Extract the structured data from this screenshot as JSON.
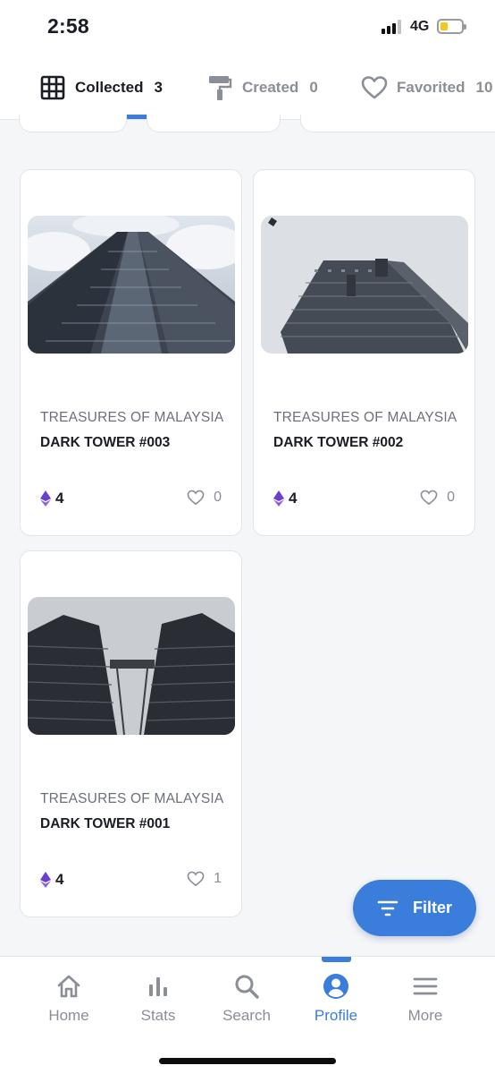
{
  "status_bar": {
    "time": "2:58",
    "network": "4G",
    "battery_level": 0.3
  },
  "tabs": [
    {
      "label": "Collected",
      "count": "3",
      "icon": "grid-icon",
      "active": true
    },
    {
      "label": "Created",
      "count": "0",
      "icon": "paint-roller-icon",
      "active": false
    },
    {
      "label": "Favorited",
      "count": "10",
      "icon": "heart-icon",
      "active": false
    }
  ],
  "cards": [
    {
      "collection": "TREASURES OF MALAYSIA",
      "name": "DARK TOWER #003",
      "price": "4",
      "likes": "0",
      "currency_icon": "ethereum-icon"
    },
    {
      "collection": "TREASURES OF MALAYSIA",
      "name": "DARK TOWER #002",
      "price": "4",
      "likes": "0",
      "currency_icon": "ethereum-icon"
    },
    {
      "collection": "TREASURES OF MALAYSIA",
      "name": "DARK TOWER #001",
      "price": "4",
      "likes": "1",
      "currency_icon": "ethereum-icon"
    }
  ],
  "filter_button": {
    "label": "Filter",
    "icon": "filter-icon"
  },
  "bottom_nav": [
    {
      "label": "Home",
      "icon": "home-icon",
      "active": false
    },
    {
      "label": "Stats",
      "icon": "bar-chart-icon",
      "active": false
    },
    {
      "label": "Search",
      "icon": "search-icon",
      "active": false
    },
    {
      "label": "Profile",
      "icon": "user-circle-icon",
      "active": true
    },
    {
      "label": "More",
      "icon": "menu-icon",
      "active": false
    }
  ],
  "colors": {
    "accent": "#3b7ddb",
    "ethereum": "#6a3fd1",
    "text_primary": "#1a1d24",
    "text_secondary": "#8a8e97"
  }
}
